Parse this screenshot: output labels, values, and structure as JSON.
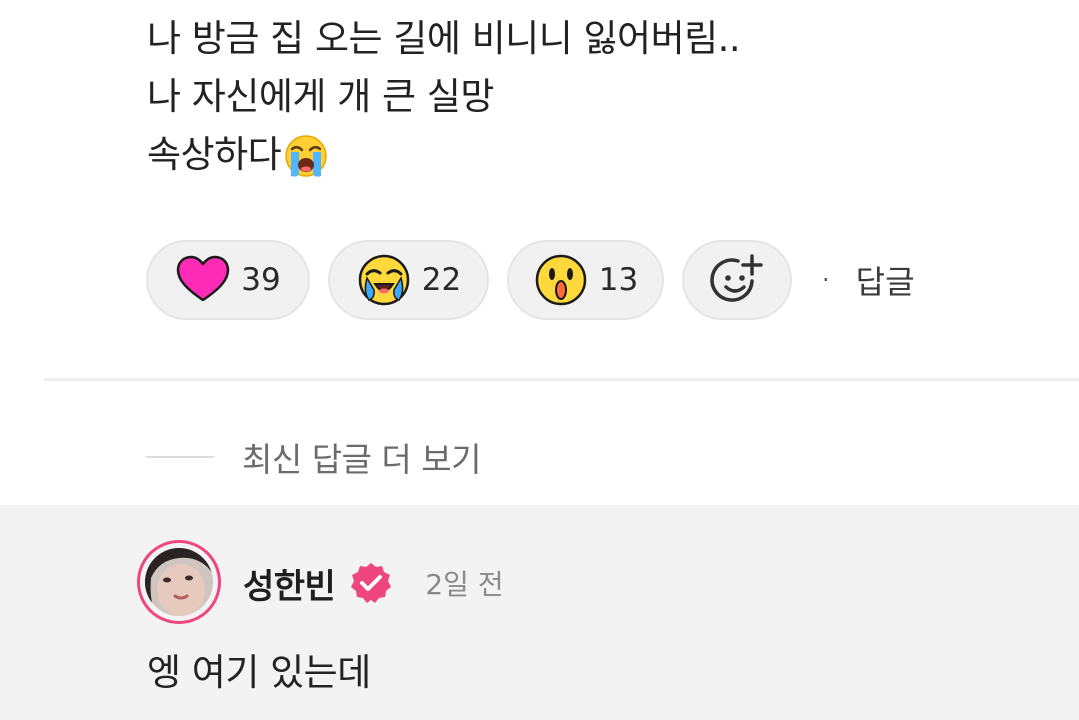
{
  "post": {
    "lines": [
      "나 방금 집 오는 길에 비니니 잃어버림..",
      "나 자신에게 개 큰 실망",
      "속상하다"
    ],
    "trailing_emoji": "loudly-crying-face-icon"
  },
  "reactions": {
    "heart": {
      "icon": "heart-icon",
      "count": "39"
    },
    "crying": {
      "icon": "crying-face-icon",
      "count": "22"
    },
    "shocked": {
      "icon": "shocked-face-icon",
      "count": "13"
    },
    "add": {
      "icon": "add-reaction-icon"
    }
  },
  "reply_link": {
    "separator": "·",
    "label": "답글"
  },
  "more_replies": {
    "label": "최신 답글 더 보기"
  },
  "reply": {
    "author": "성한빈",
    "badge": "verified-badge-icon",
    "time": "2일 전",
    "text": "엥 여기 있는데"
  },
  "colors": {
    "heart": "#ff2bb6",
    "accent_pink": "#f0467e",
    "emoji_yellow": "#ffd93b",
    "tear_blue": "#3da9ff",
    "reply_bg": "#f3f3f3"
  }
}
